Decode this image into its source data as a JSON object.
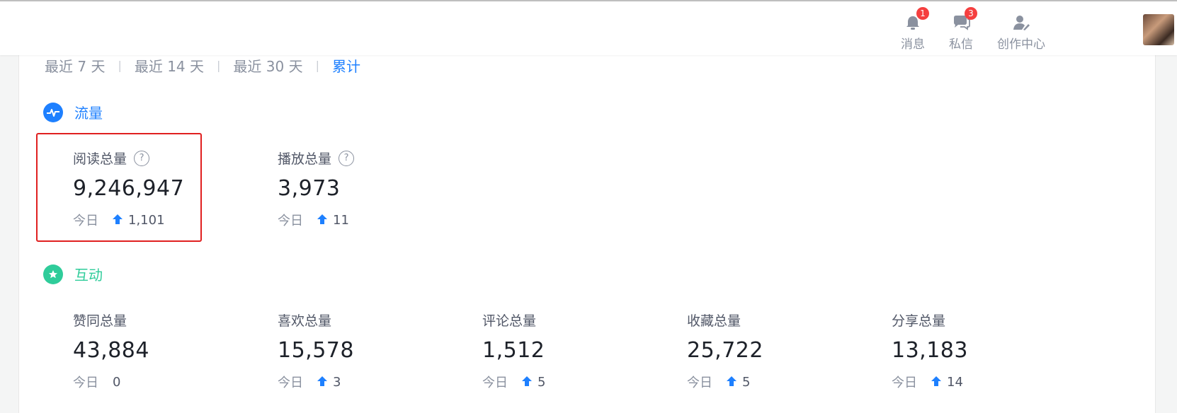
{
  "header": {
    "notifications": {
      "label": "消息",
      "badge": "1"
    },
    "messages": {
      "label": "私信",
      "badge": "3"
    },
    "creator": {
      "label": "创作中心"
    }
  },
  "ranges": [
    {
      "label": "最近 7 天",
      "active": false
    },
    {
      "label": "最近 14 天",
      "active": false
    },
    {
      "label": "最近 30 天",
      "active": false
    },
    {
      "label": "累计",
      "active": true
    }
  ],
  "sections": {
    "traffic": {
      "title": "流量",
      "color": "#1e80ff",
      "metrics": [
        {
          "label": "阅读总量",
          "value": "9,246,947",
          "today_label": "今日",
          "delta": "1,101"
        },
        {
          "label": "播放总量",
          "value": "3,973",
          "today_label": "今日",
          "delta": "11"
        }
      ]
    },
    "interaction": {
      "title": "互动",
      "color": "#2fcc9a",
      "metrics": [
        {
          "label": "赞同总量",
          "value": "43,884",
          "today_label": "今日",
          "delta": "0"
        },
        {
          "label": "喜欢总量",
          "value": "15,578",
          "today_label": "今日",
          "delta": "3"
        },
        {
          "label": "评论总量",
          "value": "1,512",
          "today_label": "今日",
          "delta": "5"
        },
        {
          "label": "收藏总量",
          "value": "25,722",
          "today_label": "今日",
          "delta": "5"
        },
        {
          "label": "分享总量",
          "value": "13,183",
          "today_label": "今日",
          "delta": "14"
        }
      ]
    }
  },
  "colors": {
    "accent": "#1e80ff",
    "highlight_border": "#e02020",
    "badge": "#f53f3f"
  }
}
